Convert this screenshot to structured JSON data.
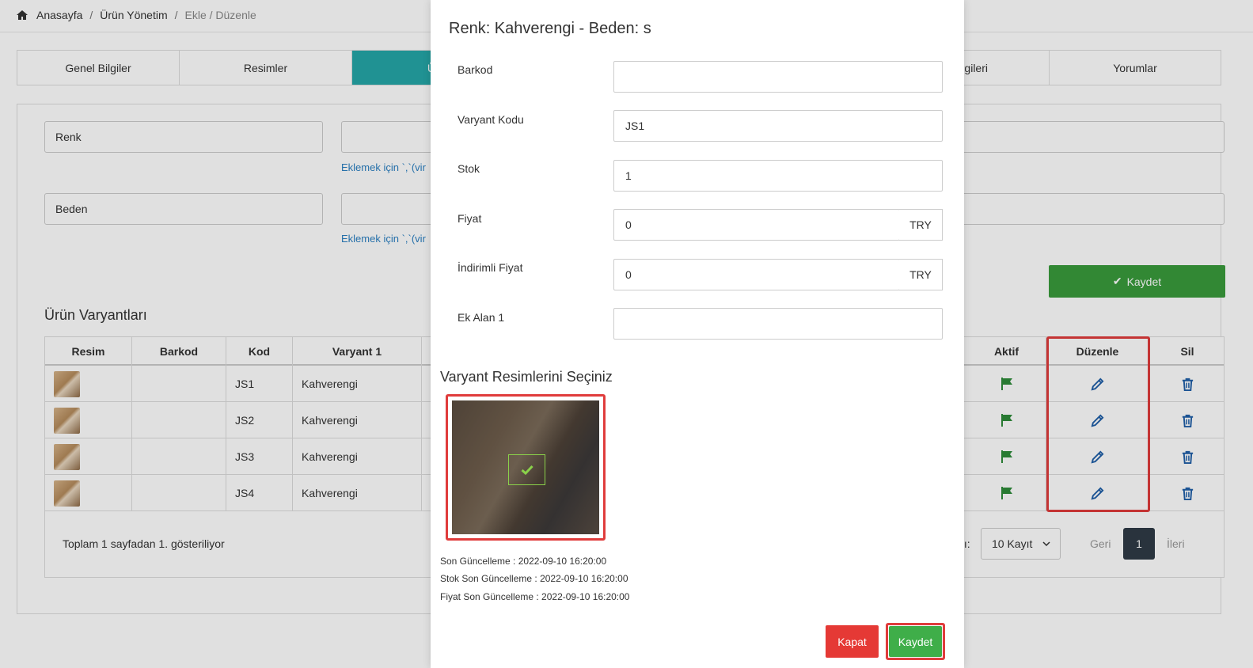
{
  "breadcrumb": {
    "home": "Anasayfa",
    "sep": "/",
    "section": "Ürün Yönetim",
    "current": "Ekle / Düzenle"
  },
  "tabs": [
    {
      "label": "Genel Bilgiler"
    },
    {
      "label": "Resimler"
    },
    {
      "label": "Ürün"
    },
    {
      "label": "SEO Bilgileri"
    },
    {
      "label": "Yorumlar"
    }
  ],
  "attributes": {
    "renk": "Renk",
    "beden": "Beden",
    "hint": "Eklemek için `,`(vir"
  },
  "bg_save_label": "Kaydet",
  "variants": {
    "title": "Ürün Varyantları",
    "columns": {
      "resim": "Resim",
      "barkod": "Barkod",
      "kod": "Kod",
      "varyant1": "Varyant 1",
      "aktif": "Aktif",
      "duzenle": "Düzenle",
      "sil": "Sil"
    },
    "rows": [
      {
        "kod": "JS1",
        "varyant1": "Kahverengi"
      },
      {
        "kod": "JS2",
        "varyant1": "Kahverengi"
      },
      {
        "kod": "JS3",
        "varyant1": "Kahverengi"
      },
      {
        "kod": "JS4",
        "varyant1": "Kahverengi"
      }
    ],
    "footer": "Toplam 1 sayfadan 1. gösteriliyor",
    "page_size_label": "ısı:",
    "page_size": "10 Kayıt",
    "prev": "Geri",
    "page": "1",
    "next": "İleri"
  },
  "modal": {
    "title": "Renk: Kahverengi - Beden: s",
    "fields": {
      "barkod": {
        "label": "Barkod",
        "value": ""
      },
      "varyant_kodu": {
        "label": "Varyant Kodu",
        "value": "JS1"
      },
      "stok": {
        "label": "Stok",
        "value": "1"
      },
      "fiyat": {
        "label": "Fiyat",
        "value": "0",
        "currency": "TRY"
      },
      "indirimli_fiyat": {
        "label": "İndirimli Fiyat",
        "value": "0",
        "currency": "TRY"
      },
      "ek_alan_1": {
        "label": "Ek Alan 1",
        "value": ""
      }
    },
    "images_title": "Varyant Resimlerini Seçiniz",
    "meta": {
      "son_guncelleme": "Son Güncelleme : 2022-09-10 16:20:00",
      "stok_son_guncelleme": "Stok Son Güncelleme : 2022-09-10 16:20:00",
      "fiyat_son_guncelleme": "Fiyat Son Güncelleme : 2022-09-10 16:20:00"
    },
    "close_label": "Kapat",
    "save_label": "Kaydet"
  },
  "colors": {
    "accent_teal": "#25a7a8",
    "success_green": "#3fae49",
    "danger_red": "#e53935",
    "highlight_red": "#e03c3c",
    "link_blue": "#2a7fc1"
  }
}
